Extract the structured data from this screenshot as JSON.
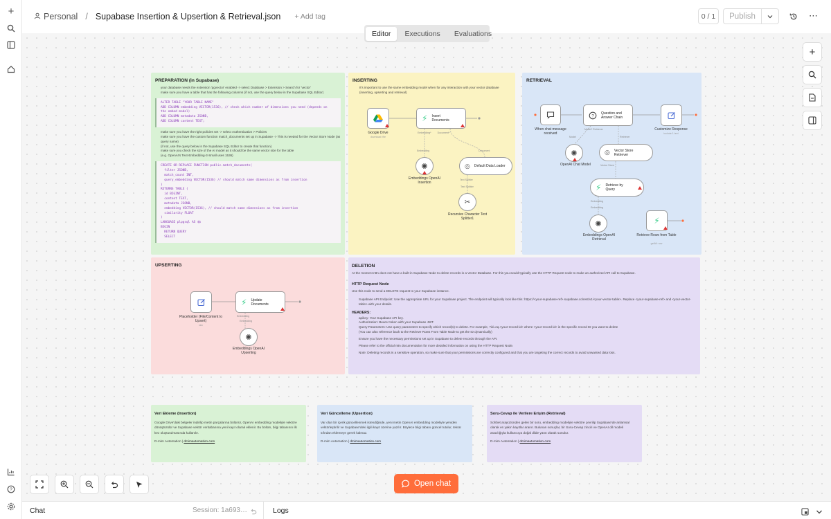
{
  "breadcrumb": {
    "project": "Personal",
    "separator": "/",
    "workflow_name": "Supabase Insertion & Upsertion & Retrieval.json",
    "add_tag": "+ Add tag"
  },
  "header": {
    "version_count": "0 / 1",
    "publish_label": "Publish"
  },
  "tabs": [
    {
      "label": "Editor",
      "active": true
    },
    {
      "label": "Executions",
      "active": false
    },
    {
      "label": "Evaluations",
      "active": false
    }
  ],
  "sections": {
    "preparation": {
      "title": "PREPARATION (in Supabase)",
      "lines1": [
        "your database needs the extension 'pgvector' enabled -> select Database > Extension > Search for 'vector'",
        "make sure you have a table that has the following columns (if not, use the query below in the Supabase SQL Editor)"
      ],
      "code1": "ALTER TABLE \"YOUR TABLE NAME\"\nADD COLUMN embedding VECTOR(1536), // check which number of dimensions you need (depends on\nthe embed model)\nADD COLUMN metadata JSONB,\nADD COLUMN content TEXT;",
      "lines2": [
        "make sure you have the right policies set -> select Authentication > Policies",
        "make sure you have the custom function match_documents set up in Supabase -> This is needed for the Vector Store Node (as query name)",
        "(if not, use the query below in the Supabase SQL Editor to create that function)",
        "make sure you check the size of the AI model as it should be the same vector size for the table",
        "(e.g. OpenAI's Text-Embedding-3-Small uses 1536)"
      ],
      "code2": "CREATE OR REPLACE FUNCTION public.match_documents(\n  filter JSONB,\n  match_count INT,\n  query_embedding VECTOR(1536) // should match same dimensions as from insertion\n)\nRETURNS TABLE (\n  id BIGINT,\n  content TEXT,\n  metadata JSONB,\n  embedding VECTOR(1536), // should match same dimensions as from insertion\n  similarity FLOAT\n)\nLANGUAGE plpgsql AS $$\nBEGIN\n  RETURN QUERY\n  SELECT"
    },
    "inserting": {
      "title": "INSERTING",
      "intro": "It's important to use the same embedding model when for any interaction with your vector database (inserting, upserting and retrieval)",
      "nodes": {
        "gdrive": "Google Drive",
        "gdrive_sub": "download: file",
        "insert": "Insert Documents",
        "embeddings": "Embeddings OpenAI Insertion",
        "loader": "Default Data Loader",
        "splitter": "Recursive Character Text Splitter1"
      },
      "edges": {
        "embedding": "Embedding",
        "document": "Document",
        "text_splitter": "Text Splitter"
      }
    },
    "retrieval": {
      "title": "RETRIEVAL",
      "nodes": {
        "chat_trigger": "When chat message received",
        "qa_chain": "Question and Answer Chain",
        "customize": "Customize Response",
        "customize_sub": "include 1 text",
        "chat_model": "OpenAI Chat Model",
        "vs_retriever": "Vector Store Retriever",
        "retrieve_query": "Retrieve by Query",
        "embeddings": "Embeddings OpenAI Retrieval",
        "retrieve_rows": "Retrieve Rows from Table",
        "retrieve_rows_sub": "getAll: row"
      },
      "edges": {
        "model_retriever": "Model*        Retriever",
        "model": "Model",
        "retriever": "Retriever",
        "vector_store": "Vector Store",
        "embedding": "Embedding"
      }
    },
    "upserting": {
      "title": "UPSERTING",
      "nodes": {
        "placeholder": "Placeholder (File/Content to Upsert)",
        "placeholder_sub": "raw",
        "update": "Update Documents",
        "embeddings": "Embeddings OpenAI Upserting"
      },
      "edges": {
        "embedding": "Embedding"
      }
    },
    "deletion": {
      "title": "DELETION",
      "intro": "At the moment n8n does not have a built-in Supabase Node to delete records in a Vector Database. For this you would typically use the HTTP Request node to make an authorized API call to Supabase.",
      "http_title": "HTTP Request Node",
      "http_desc": "Use this node to send a DELETE request to your Supabase instance.",
      "endpoint": "Supabase API Endpoint: Use the appropriate URL for your Supabase project. The endpoint will typically look like this: https://<your-supabase-ref>.supabase.co/rest/v1/<your-vector-table>. Replace <your-supabase-ref> and <your-vector-table> with your details.",
      "headers_title": "HEADERS:",
      "headers": [
        "apikey: Your Supabase API key.",
        "Authorization: Bearer token with your Supabase JWT.",
        "Query Parameters: Use query parameters to specify which record(s) to delete. For example, ?id=eq.<your-record-id> where <your-record-id> is the specific record ID you want to delete",
        "(You can also reference back to the Retrieve Rows From Table Node to get the ID dynamically)",
        "Ensure you have the necessary permissions set up in Supabase to delete records through the API.",
        "Please refer to the official n8n documentation for more detailed information on using the HTTP Request Node.",
        "Note: Deleting records is a sensitive operation, so make sure that your permissions are correctly configured and that you are targeting the correct records to avoid unwanted data loss."
      ]
    }
  },
  "cards": [
    {
      "title": "Veri Ekleme (Insertion)",
      "body": "Google Drive'daki belgeler indirilip metin parçalarına bölünür, OpenAI embedding modeliyle vektöre dönüştürülür ve Supabase vektör veritabanına yeni kayıt olarak eklenir. Bu bölüm, bilgi tabanının ilk kez oluşturulmasında kullanılır.",
      "footer_prefix": "D-mim Automation | ",
      "footer_link": "dmimautomation.com",
      "color": "#d9f2d5"
    },
    {
      "title": "Veri Güncelleme (Upsertion)",
      "body": "Var olan bir içerik güncellenmek istendiğinde, yeni metin OpenAI embedding modeliyle yeniden vektörleştirilir ve Supabase'deki ilgili kayıt üzerine yazılır. Böylece bilgi tabanı güncel tutulur, tekrar sıfırdan eklemeye gerek kalmaz.",
      "footer_prefix": "D-mim Automation | ",
      "footer_link": "dmimautomation.com",
      "color": "#d9e6f7"
    },
    {
      "title": "Soru-Cevap ile Verilere Erişim (Retrieval)",
      "body": "Sohbet arayüzünden gelen bir soru, embedding modeliyle vektöre çevrilip Supabase'de anlamsal olarak en yakın kayıtlar aranır. Bulunan sonuçlar, bir Soru-Cevap zinciri ve OpenAI dil modeli aracılığıyla kullanıcıya doğal dilde yanıt olarak sunulur.",
      "footer_prefix": "D-mim Automation | ",
      "footer_link": "dmimautomation.com",
      "color": "#e4dcf5"
    }
  ],
  "open_chat": "Open chat",
  "bottom": {
    "chat": "Chat",
    "session": "Session: 1a693…",
    "logs": "Logs"
  },
  "colors": {
    "accent": "#ff6d3b",
    "prep": "#d9f2d5",
    "insert": "#fbf3c2",
    "retrieval": "#d9e6f7",
    "upsert": "#fbdcdc",
    "delete": "#e4dcf5"
  }
}
